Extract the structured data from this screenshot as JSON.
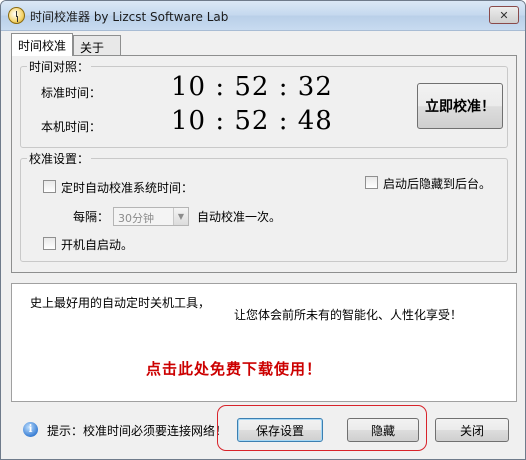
{
  "window": {
    "title": "时间校准器 by Lizcst Software Lab",
    "close_glyph": "✕"
  },
  "tabs": [
    {
      "label": "时间校准",
      "active": true
    },
    {
      "label": "关于",
      "active": false
    }
  ],
  "time_compare": {
    "legend": "时间对照：",
    "standard_label": "标准时间：",
    "standard_value": "10 : 52 : 32",
    "local_label": "本机时间：",
    "local_value": "10 : 52 : 48",
    "calibrate_button": "立即校准！"
  },
  "settings": {
    "legend": "校准设置：",
    "auto_calibrate_label": "定时自动校准系统时间：",
    "interval_prefix": "每隔：",
    "interval_value": "30分钟",
    "interval_suffix": "自动校准一次。",
    "hide_after_start_label": "启动后隐藏到后台。",
    "autostart_label": "开机自启动。"
  },
  "ad": {
    "line1": "史上最好用的自动定时关机工具，",
    "line2": "让您体会前所未有的智能化、人性化享受！",
    "download_link": "点击此处免费下载使用！",
    "link_color": "#cc0000"
  },
  "footer": {
    "hint": "提示：校准时间必须要连接网络！",
    "save_button": "保存设置",
    "hide_button": "隐藏",
    "close_button": "关闭"
  },
  "annotation": {
    "highlight_color": "#d8232a"
  }
}
